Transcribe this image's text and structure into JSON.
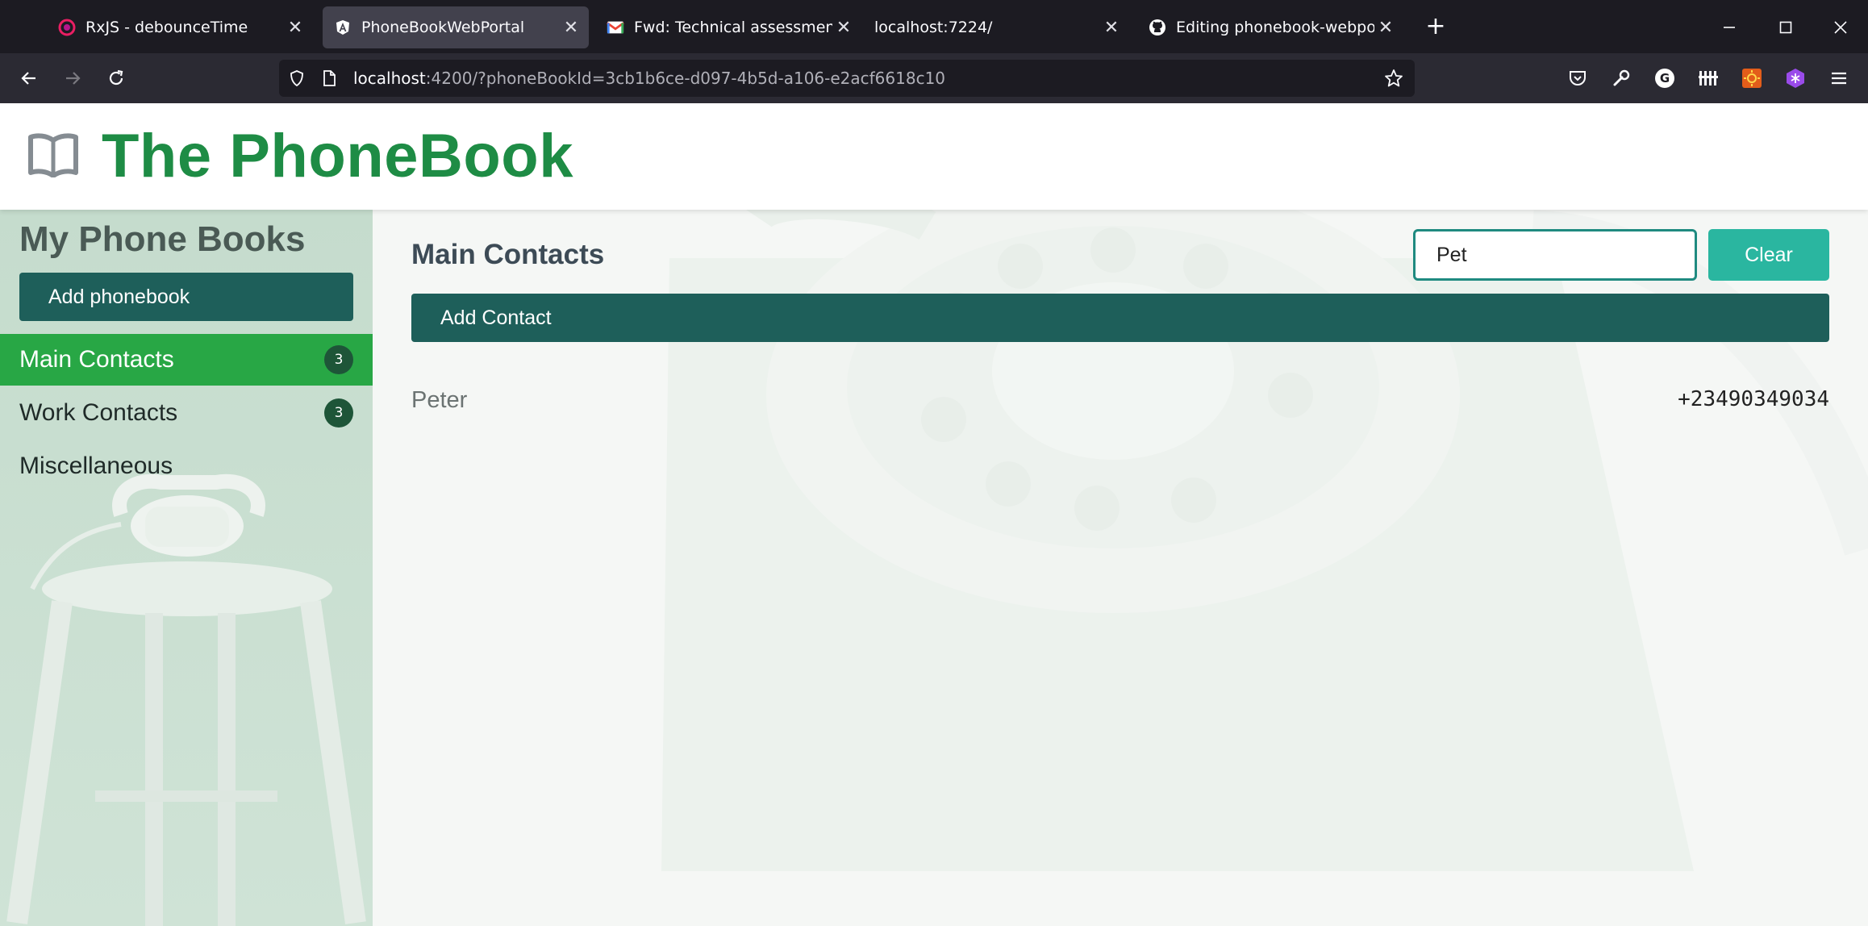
{
  "browser": {
    "tabs": [
      {
        "title": "RxJS - debounceTime",
        "favicon": "rxjs-icon",
        "active": false
      },
      {
        "title": "PhoneBookWebPortal",
        "favicon": "angular-icon",
        "active": true
      },
      {
        "title": "Fwd: Technical assessment Gera",
        "favicon": "gmail-icon",
        "active": false
      },
      {
        "title": "localhost:7224/",
        "favicon": "",
        "active": false
      },
      {
        "title": "Editing phonebook-webportal/",
        "favicon": "github-icon",
        "active": false
      }
    ],
    "url": {
      "host": "localhost",
      "rest": ":4200/?phoneBookId=3cb1b6ce-d097-4b5d-a106-e2acf6618c10"
    }
  },
  "app": {
    "title": "The PhoneBook"
  },
  "sidebar": {
    "title": "My Phone Books",
    "add_label": "Add phonebook",
    "items": [
      {
        "label": "Main Contacts",
        "count": "3",
        "active": true
      },
      {
        "label": "Work Contacts",
        "count": "3",
        "active": false
      },
      {
        "label": "Miscellaneous",
        "count": "",
        "active": false
      }
    ]
  },
  "main": {
    "title": "Main Contacts",
    "search_value": "Pet",
    "clear_label": "Clear",
    "add_contact_label": "Add Contact",
    "contacts": [
      {
        "name": "Peter",
        "phone": "+23490349034"
      }
    ]
  },
  "colors": {
    "brand": "#1e8c45",
    "active_item": "#28a745",
    "primary_button": "#1e5f5a",
    "clear_button": "#2ab6a0"
  }
}
